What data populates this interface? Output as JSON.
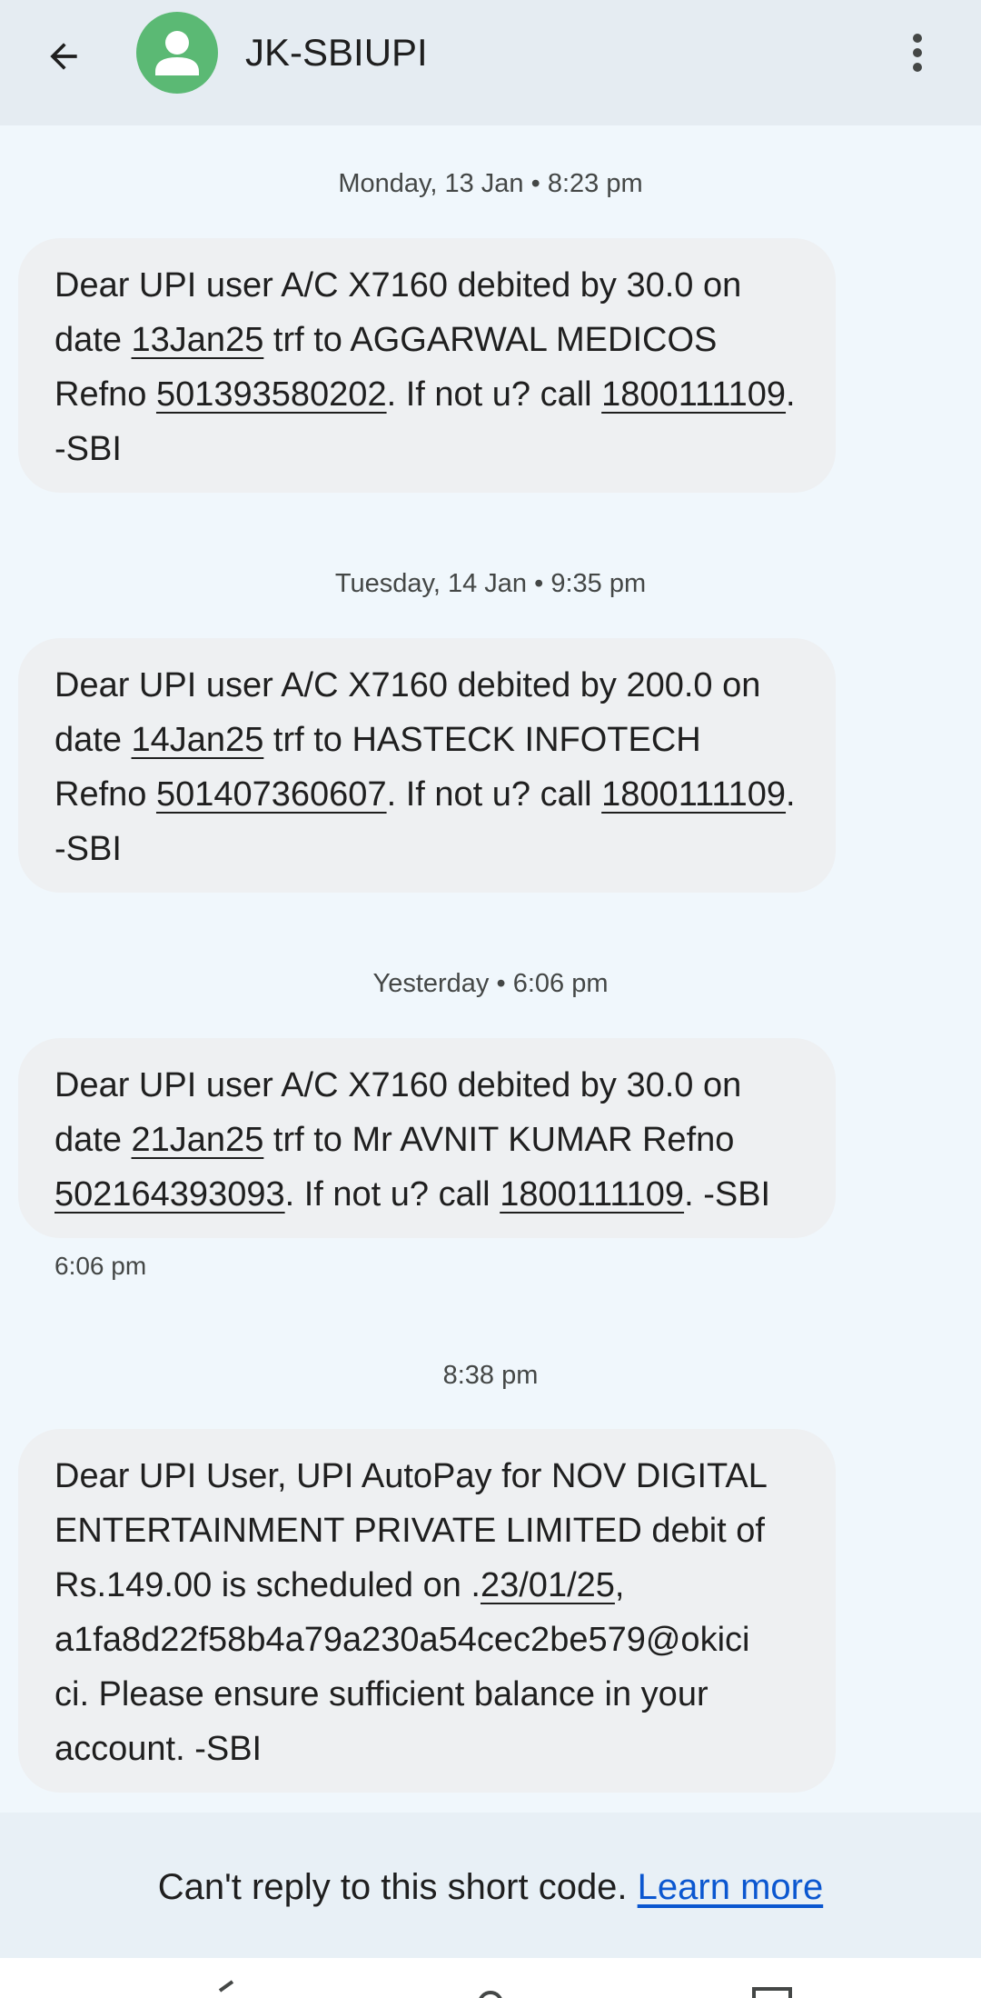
{
  "header": {
    "title": "JK-SBIUPI",
    "back_icon": "arrow-back-icon",
    "menu_icon": "more-vert-icon",
    "avatar_color": "#5bb974"
  },
  "messages": [
    {
      "stamp": "Monday, 13 Jan • 8:23 pm",
      "p1": "Dear UPI user A/C X7160 debited by 30.0 on date ",
      "date": "13Jan25",
      "p2": " trf to AGGARWAL MEDICOS Refno ",
      "ref": "501393580202",
      "p3": ". If not u? call ",
      "phone": "1800111109",
      "p4": ". -SBI"
    },
    {
      "stamp": "Tuesday, 14 Jan • 9:35 pm",
      "p1": "Dear UPI user A/C X7160 debited by 200.0 on date ",
      "date": "14Jan25",
      "p2": " trf to HASTECK INFOTECH Refno ",
      "ref": "501407360607",
      "p3": ". If not u? call ",
      "phone": "1800111109",
      "p4": ". -SBI"
    },
    {
      "stamp": "Yesterday • 6:06 pm",
      "p1": "Dear UPI user A/C X7160 debited by 30.0 on date ",
      "date": "21Jan25",
      "p2": " trf to Mr AVNIT KUMAR Refno ",
      "ref": "502164393093",
      "p3": ". If not u? call ",
      "phone": "1800111109",
      "p4": ". -SBI",
      "time": "6:06 pm"
    },
    {
      "stamp": "8:38 pm",
      "l1": "Dear UPI User, UPI AutoPay for NOV DIGITAL",
      "l2": "ENTERTAINMENT PRIVATE LIMITED debit of",
      "l3a": "Rs.149.00 is scheduled on .",
      "l3date": "23/01/25",
      "l3b": ",",
      "l4": "a1fa8d22f58b4a79a230a54cec2be579@okici",
      "l5": "ci. Please ensure sufficient balance in your",
      "l6": "account. -SBI"
    }
  ],
  "footer": {
    "text": "Can't reply to this short code. ",
    "link": "Learn more",
    "link_color": "#0b57d0"
  }
}
